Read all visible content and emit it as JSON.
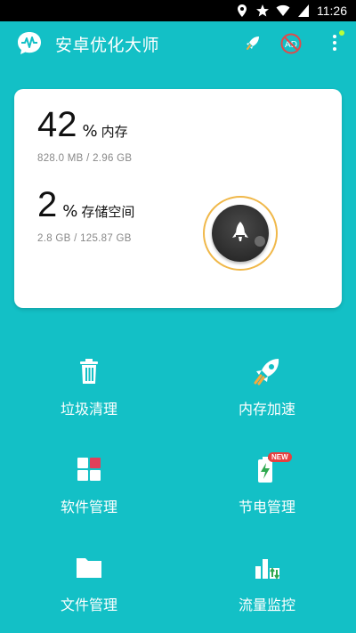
{
  "status_bar": {
    "icons": [
      "location-icon",
      "star-icon",
      "wifi-icon",
      "battery-icon"
    ],
    "time": "11:26"
  },
  "app_bar": {
    "title": "安卓优化大师",
    "actions": [
      "rocket-icon",
      "ad-block-icon",
      "more-vert-icon"
    ]
  },
  "summary": {
    "memory": {
      "percent": "42",
      "unit": "%",
      "label": "内存",
      "detail": "828.0 MB  /  2.96 GB"
    },
    "storage": {
      "percent": "2",
      "unit": "%",
      "label": "存储空间",
      "detail": "2.8 GB  /  125.87 GB"
    },
    "boost_button_icon": "rocket-icon"
  },
  "features": [
    {
      "label": "垃圾清理",
      "icon": "trash-icon"
    },
    {
      "label": "内存加速",
      "icon": "rocket-icon"
    },
    {
      "label": "软件管理",
      "icon": "apps-grid-icon"
    },
    {
      "label": "节电管理",
      "icon": "battery-charge-icon",
      "badge": "NEW"
    },
    {
      "label": "文件管理",
      "icon": "folder-icon"
    },
    {
      "label": "流量监控",
      "icon": "traffic-chart-icon"
    }
  ],
  "colors": {
    "background": "#13c0c6",
    "card": "#ffffff",
    "boost_ring": "#f0b84a",
    "badge": "#e64040",
    "indicator": "#b9ff3a"
  }
}
